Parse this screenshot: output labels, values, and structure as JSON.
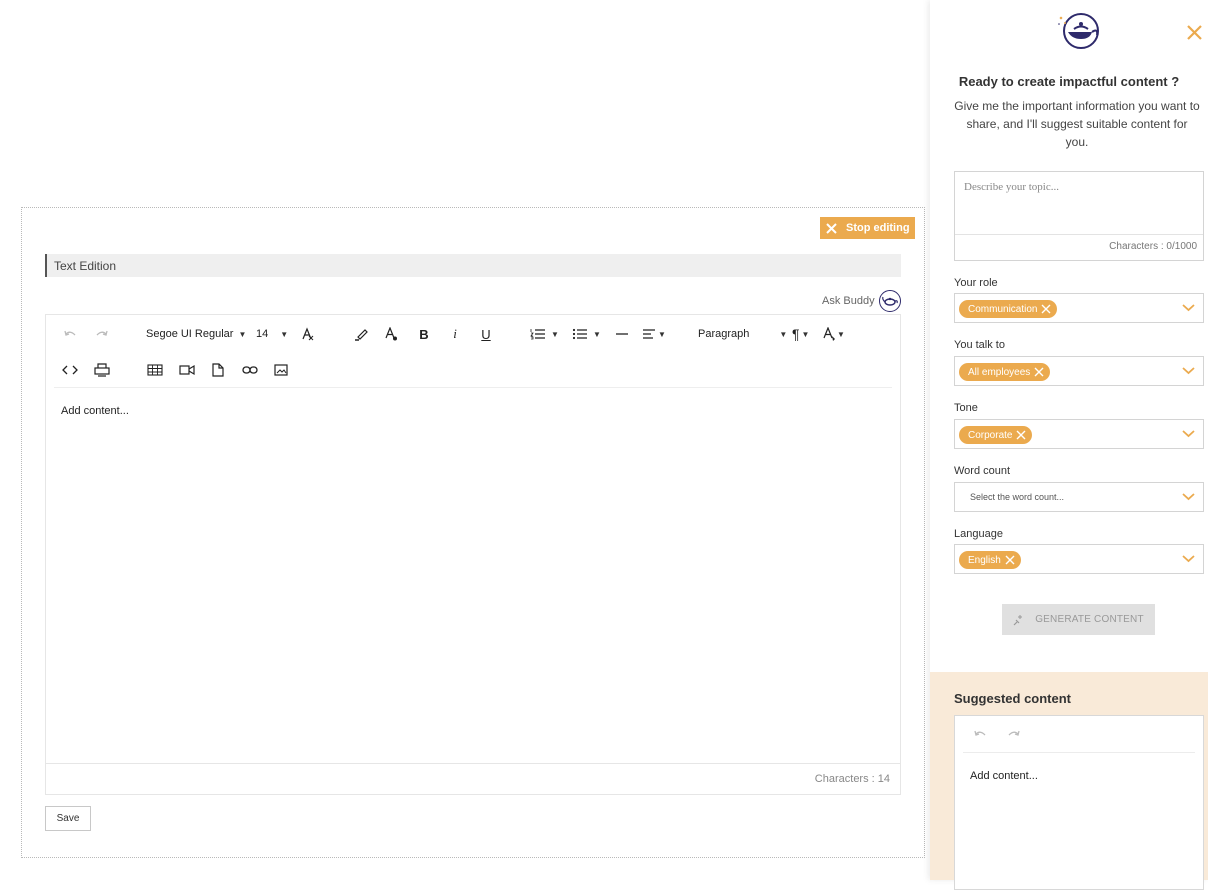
{
  "editor": {
    "stop_editing_label": "Stop editing",
    "section_title": "Text Edition",
    "ask_buddy_label": "Ask Buddy",
    "toolbar": {
      "font_family": "Segoe UI Regular",
      "font_size": "14",
      "block_format": "Paragraph"
    },
    "content_placeholder": "Add content...",
    "char_count": "Characters : 14",
    "save_label": "Save"
  },
  "panel": {
    "title": "Ready to create impactful content ?",
    "subtitle": "Give me the important information you want to share, and I'll suggest suitable content for you.",
    "topic_placeholder": "Describe your topic...",
    "topic_count": "Characters : 0/1000",
    "role_label": "Your role",
    "role_value": "Communication",
    "audience_label": "You talk to",
    "audience_value": "All employees",
    "tone_label": "Tone",
    "tone_value": "Corporate",
    "wordcount_label": "Word count",
    "wordcount_placeholder": "Select the word count...",
    "language_label": "Language",
    "language_value": "English",
    "generate_label": "GENERATE CONTENT",
    "suggested_title": "Suggested content",
    "suggested_placeholder": "Add content..."
  },
  "colors": {
    "accent": "#ebaa4e",
    "brand_purple": "#2e2a6b",
    "suggest_bg": "#f9ead8"
  }
}
